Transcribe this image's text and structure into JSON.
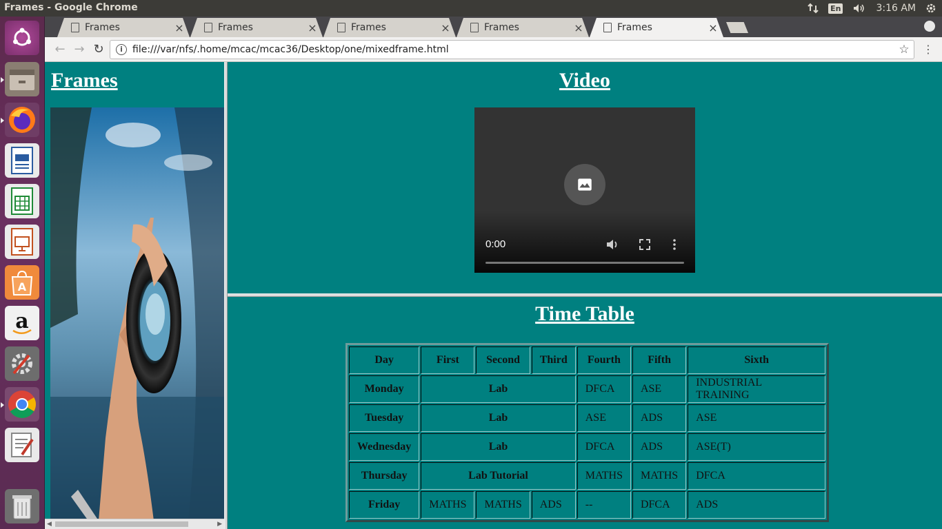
{
  "window": {
    "title": "Frames - Google Chrome"
  },
  "tray": {
    "keyboard": "En",
    "clock": "3:16 AM"
  },
  "tabs": [
    {
      "title": "Frames"
    },
    {
      "title": "Frames"
    },
    {
      "title": "Frames"
    },
    {
      "title": "Frames"
    },
    {
      "title": "Frames"
    }
  ],
  "address": {
    "url": "file:///var/nfs/.home/mcac/mcac36/Desktop/one/mixedframe.html"
  },
  "left_frame": {
    "heading": "Frames"
  },
  "video_frame": {
    "heading": "Video",
    "time": "0:00"
  },
  "timetable": {
    "heading": "Time Table",
    "headers": [
      "Day",
      "First",
      "Second",
      "Third",
      "Fourth",
      "Fifth",
      "Sixth"
    ],
    "rows": [
      {
        "day": "Monday",
        "lab": "Lab",
        "fourth": "DFCA",
        "fifth": "ASE",
        "sixth": "INDUSTRIAL TRAINING"
      },
      {
        "day": "Tuesday",
        "lab": "Lab",
        "fourth": "ASE",
        "fifth": "ADS",
        "sixth": "ASE"
      },
      {
        "day": "Wednesday",
        "lab": "Lab",
        "fourth": "DFCA",
        "fifth": "ADS",
        "sixth": "ASE(T)"
      },
      {
        "day": "Thursday",
        "lab": "Lab Tutorial",
        "fourth": "MATHS",
        "fifth": "MATHS",
        "sixth": "DFCA"
      }
    ],
    "friday": {
      "day": "Friday",
      "first": "MATHS",
      "second": "MATHS",
      "third": "ADS",
      "fourth": "--",
      "fifth": "DFCA",
      "sixth": "ADS"
    }
  },
  "colors": {
    "page_bg": "#008080",
    "launcher": "#5c2a4d",
    "chrome_bar": "#f2f1f0"
  },
  "launcher_icons": [
    "ubuntu-dash-icon",
    "files-icon",
    "firefox-icon",
    "writer-icon",
    "calc-icon",
    "impress-icon",
    "software-center-icon",
    "amazon-icon",
    "system-settings-icon",
    "chrome-icon",
    "text-editor-icon",
    "trash-icon"
  ]
}
